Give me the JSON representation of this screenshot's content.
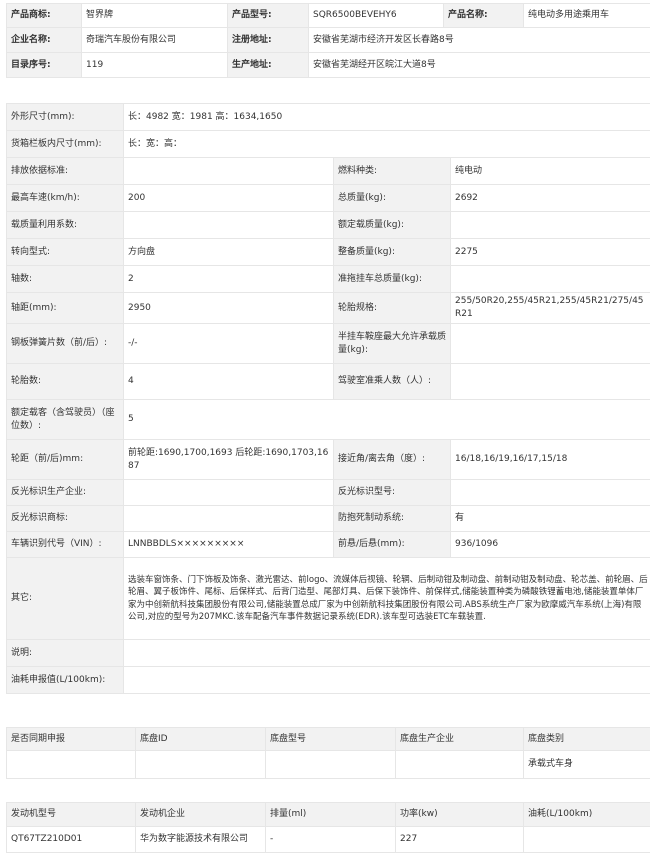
{
  "product_info": {
    "trademark_label": "产品商标:",
    "trademark_value": "智界牌",
    "model_label": "产品型号:",
    "model_value": "SQR6500BEVEHY6",
    "name_label": "产品名称:",
    "name_value": "纯电动多用途乘用车",
    "company_label": "企业名称:",
    "company_value": "奇瑞汽车股份有限公司",
    "reg_addr_label": "注册地址:",
    "reg_addr_value": "安徽省芜湖市经济开发区长春路8号",
    "catalog_label": "目录序号:",
    "catalog_value": "119",
    "prod_addr_label": "生产地址:",
    "prod_addr_value": "安徽省芜湖经开区皖江大道8号"
  },
  "specs": {
    "dimensions_label": "外形尺寸(mm):",
    "dimensions_value": "长：4982 宽：1981 高：1634,1650",
    "cargo_label": "货箱栏板内尺寸(mm):",
    "cargo_value": "长：宽：高：",
    "emission_label": "排放依据标准:",
    "emission_value": "",
    "fuel_label": "燃料种类:",
    "fuel_value": "纯电动",
    "max_speed_label": "最高车速(km/h):",
    "max_speed_value": "200",
    "total_mass_label": "总质量(kg):",
    "total_mass_value": "2692",
    "load_util_label": "载质量利用系数:",
    "load_util_value": "",
    "rated_load_label": "额定载质量(kg):",
    "rated_load_value": "",
    "steering_label": "转向型式:",
    "steering_value": "方向盘",
    "curb_mass_label": "整备质量(kg):",
    "curb_mass_value": "2275",
    "axles_label": "轴数:",
    "axles_value": "2",
    "trailer_mass_label": "准拖挂车总质量(kg):",
    "trailer_mass_value": "",
    "wheelbase_label": "轴距(mm):",
    "wheelbase_value": "2950",
    "tire_label": "轮胎规格:",
    "tire_value": "255/50R20,255/45R21,255/45R21/275/45R21",
    "leaf_spring_label": "钢板弹簧片数（前/后）:",
    "leaf_spring_value": "-/-",
    "saddle_label": "半挂车鞍座最大允许承载质量(kg):",
    "saddle_value": "",
    "tire_count_label": "轮胎数:",
    "tire_count_value": "4",
    "cab_pass_label": "驾驶室准乘人数（人）:",
    "cab_pass_value": "",
    "rated_pass_label": "额定载客（含驾驶员）（座位数）:",
    "rated_pass_value": "5",
    "track_label": "轮距（前/后)mm:",
    "track_value": "前轮距:1690,1700,1693 后轮距:1690,1703,1687",
    "approach_label": "接近角/离去角（度）:",
    "approach_value": "16/18,16/19,16/17,15/18",
    "reflect_co_label": "反光标识生产企业:",
    "reflect_co_value": "",
    "reflect_model_label": "反光标识型号:",
    "reflect_model_value": "",
    "reflect_brand_label": "反光标识商标:",
    "reflect_brand_value": "",
    "abs_label": "防抱死制动系统:",
    "abs_value": "有",
    "vin_label": "车辆识别代号（VIN）:",
    "vin_value": "LNNBBDLS×××××××××",
    "overhang_label": "前悬/后悬(mm):",
    "overhang_value": "936/1096",
    "other_label": "其它:",
    "other_value": "选装车窗饰条、门下饰板及饰条、激光雷达、前logo、流媒体后视镜、轮辋、后制动钳及制动盘、前制动钳及制动盘、轮芯盖、前轮眉、后轮眉、翼子板饰件、尾标、后保样式、后背门造型、尾部灯具、后保下装饰件、前保样式,储能装置种类为磷酸铁锂蓄电池,储能装置单体厂家为中创新航科技集团股份有限公司,储能装置总成厂家为中创新航科技集团股份有限公司.ABS系统生产厂家为欧摩威汽车系统(上海)有限公司,对应的型号为207MKC.该车配备汽车事件数据记录系统(EDR).该车型可选装ETC车载装置.",
    "note_label": "说明:",
    "note_value": "",
    "fuel_decl_label": "油耗申报值(L/100km):",
    "fuel_decl_value": ""
  },
  "chassis": {
    "headers": [
      "是否同期申报",
      "底盘ID",
      "底盘型号",
      "底盘生产企业",
      "底盘类别"
    ],
    "row": [
      "",
      "",
      "",
      "",
      "承载式车身"
    ]
  },
  "engine": {
    "headers": [
      "发动机型号",
      "发动机企业",
      "排量(ml)",
      "功率(kw)",
      "油耗(L/100km)"
    ],
    "row": [
      "QT67TZ210D01",
      "华为数字能源技术有限公司",
      "-",
      "227",
      ""
    ]
  }
}
